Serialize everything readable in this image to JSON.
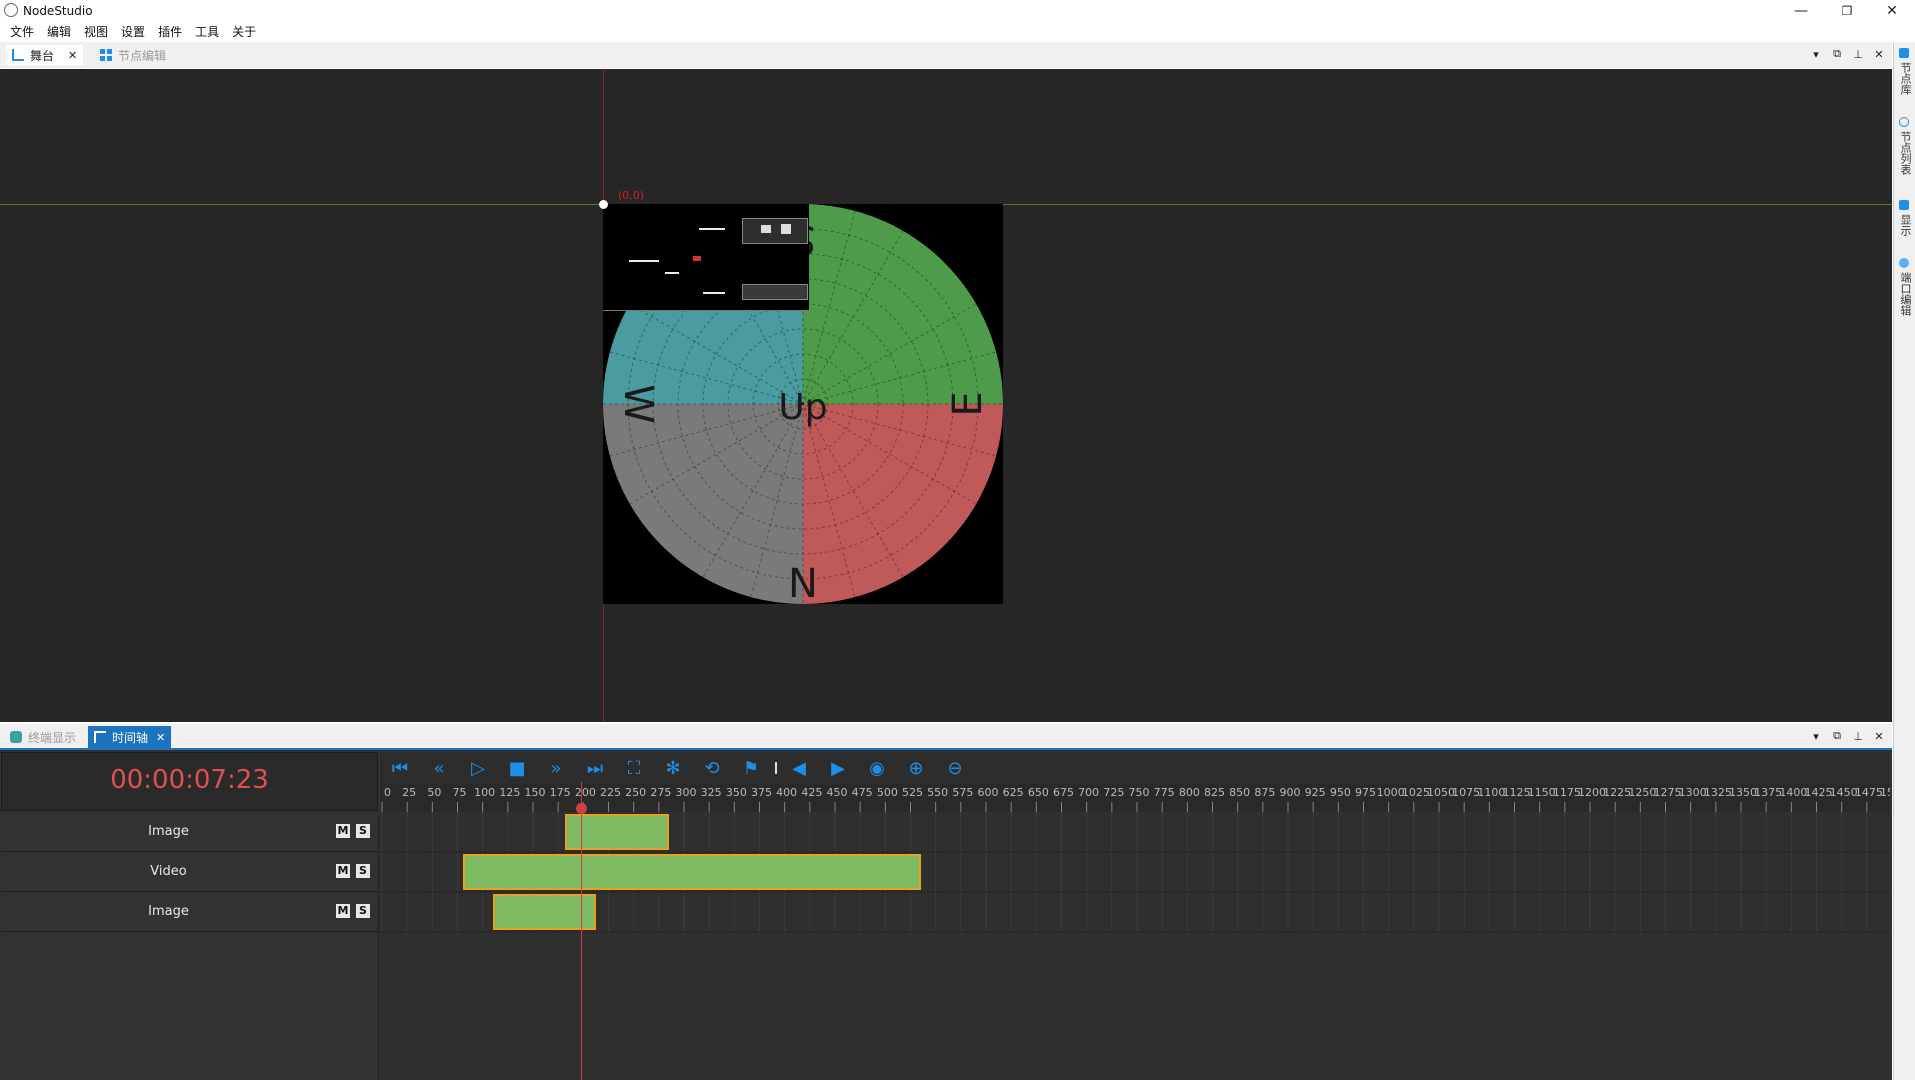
{
  "app": {
    "title": "NodeStudio"
  },
  "window_controls": {
    "minimize": "—",
    "maximize": "❐",
    "close": "✕"
  },
  "menu": [
    "文件",
    "编辑",
    "视图",
    "设置",
    "插件",
    "工具",
    "关于"
  ],
  "top_dock": {
    "tabs": [
      {
        "label": "舞台",
        "active": true,
        "close": "✕"
      },
      {
        "label": "节点编辑",
        "active": false
      }
    ],
    "controls": [
      "▾",
      "⧉",
      "⊥",
      "✕"
    ]
  },
  "side_tabs": [
    "节点库",
    "节点列表",
    "显示",
    "端口编辑"
  ],
  "stage": {
    "origin_label": "(0,0)",
    "compass": {
      "up": "Up",
      "n": "N",
      "e": "E",
      "w": "W",
      "s": "S"
    },
    "colors": {
      "bg": "#262626",
      "axis_x": "#5f7a2a",
      "axis_y": "#8a2424"
    }
  },
  "bottom_dock": {
    "tabs": [
      {
        "label": "终端显示",
        "active": false
      },
      {
        "label": "时间轴",
        "active": true,
        "close": "✕"
      }
    ],
    "controls": [
      "▾",
      "⧉",
      "⊥",
      "✕"
    ]
  },
  "timeline": {
    "timecode": "00:00:07:23",
    "toolbar_icons": [
      "skip-to-start-icon",
      "rewind-icon",
      "play-icon",
      "stop-icon",
      "fast-forward-icon",
      "skip-to-end-icon",
      "fit-icon",
      "settings-icon",
      "loop-icon",
      "marker-icon",
      "prev-key-icon",
      "next-key-icon",
      "record-icon",
      "zoom-in-icon",
      "zoom-out-icon"
    ],
    "ruler_ticks": [
      "0",
      "25",
      "50",
      "75",
      "100",
      "125",
      "150",
      "175",
      "200",
      "225",
      "250",
      "275",
      "300",
      "325",
      "350",
      "375",
      "400",
      "425",
      "450",
      "475",
      "500",
      "525",
      "550",
      "575",
      "600",
      "625",
      "650",
      "675",
      "700",
      "725",
      "750",
      "775",
      "800",
      "825",
      "850",
      "875",
      "900",
      "925",
      "950",
      "975",
      "1000",
      "1025",
      "1050",
      "1075",
      "1100",
      "1125",
      "1150",
      "1175",
      "1200",
      "1225",
      "1250",
      "1275",
      "1300",
      "1325",
      "1350",
      "1375",
      "1400",
      "1425",
      "1450",
      "1475",
      "1500"
    ],
    "playhead_frame": 198,
    "tracks": [
      {
        "name": "Image",
        "mute": "M",
        "solo": "S",
        "clip": {
          "start": 182,
          "end": 285
        }
      },
      {
        "name": "Video",
        "mute": "M",
        "solo": "S",
        "clip": {
          "start": 80,
          "end": 535
        }
      },
      {
        "name": "Image",
        "mute": "M",
        "solo": "S",
        "clip": {
          "start": 110,
          "end": 213
        }
      }
    ],
    "colors": {
      "timecode": "#e05050",
      "clip_fill": "#7dba62",
      "clip_border": "#e8a020",
      "accent": "#1e8fe8",
      "playhead": "#c84040"
    }
  }
}
